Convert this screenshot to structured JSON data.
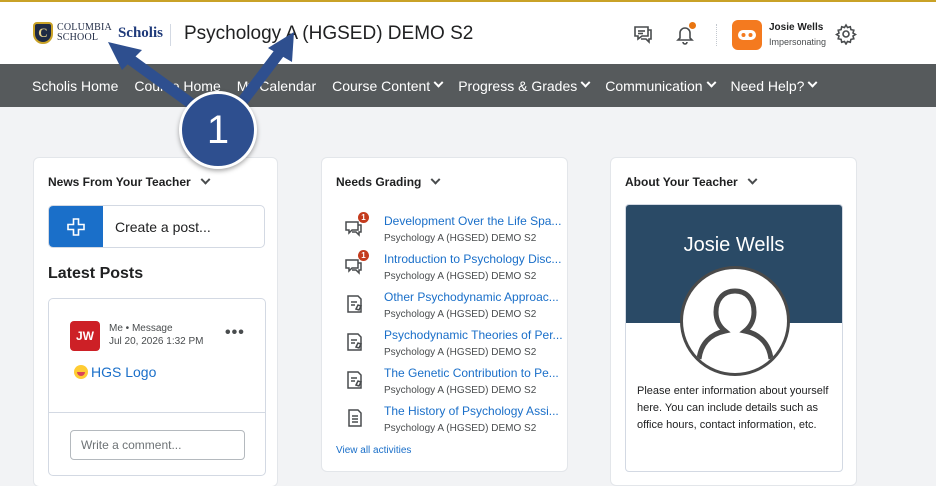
{
  "header": {
    "logo_letter": "C",
    "logo_line1": "COLUMBIA",
    "logo_line2": "SCHOOL",
    "logo_brand": "Scholis",
    "course_title": "Psychology A (HGSED) DEMO S2",
    "user_name": "Josie Wells",
    "user_status": "Impersonating",
    "icons": [
      "chat-icon",
      "bell-icon",
      "mask-icon",
      "gear-icon"
    ]
  },
  "nav": {
    "items": [
      {
        "label": "Scholis Home",
        "dropdown": false
      },
      {
        "label": "Course Home",
        "dropdown": false
      },
      {
        "label": "My Calendar",
        "dropdown": false
      },
      {
        "label": "Course Content",
        "dropdown": true
      },
      {
        "label": "Progress & Grades",
        "dropdown": true
      },
      {
        "label": "Communication",
        "dropdown": true
      },
      {
        "label": "Need Help?",
        "dropdown": true
      }
    ]
  },
  "annotation": {
    "badge": "1"
  },
  "news": {
    "title": "News From Your Teacher",
    "create_post": "Create a post...",
    "latest_title": "Latest Posts",
    "post": {
      "initials": "JW",
      "author": "Me",
      "type": "Message",
      "date": "Jul 20, 2026 1:32 PM",
      "more": "•••",
      "link": "HGS Logo"
    },
    "comment_placeholder": "Write a comment..."
  },
  "grading": {
    "title": "Needs Grading",
    "items": [
      {
        "name": "Development Over the Life Spa...",
        "course": "Psychology A (HGSED) DEMO S2",
        "icon": "discussion-icon",
        "count": "1"
      },
      {
        "name": "Introduction to Psychology Disc...",
        "course": "Psychology A (HGSED) DEMO S2",
        "icon": "discussion-icon",
        "count": "1"
      },
      {
        "name": "Other Psychodynamic Approac...",
        "course": "Psychology A (HGSED) DEMO S2",
        "icon": "assignment-icon",
        "count": ""
      },
      {
        "name": "Psychodynamic Theories of Per...",
        "course": "Psychology A (HGSED) DEMO S2",
        "icon": "assignment-icon",
        "count": ""
      },
      {
        "name": "The Genetic Contribution to Pe...",
        "course": "Psychology A (HGSED) DEMO S2",
        "icon": "assignment-icon",
        "count": ""
      },
      {
        "name": "The History of Psychology Assi...",
        "course": "Psychology A (HGSED) DEMO S2",
        "icon": "document-icon",
        "count": ""
      }
    ],
    "view_all": "View all activities"
  },
  "about": {
    "title": "About Your Teacher",
    "name": "Josie Wells",
    "text": "Please enter information about yourself here. You can include details such as office hours, contact information, etc."
  },
  "colors": {
    "nav_bg": "#565a5c",
    "link": "#1a6fc9",
    "primary": "#1a6fc9",
    "banner": "#2a4a66",
    "badge": "#2e4f8f",
    "alert": "#c43b1d",
    "orange": "#f47a1f"
  }
}
